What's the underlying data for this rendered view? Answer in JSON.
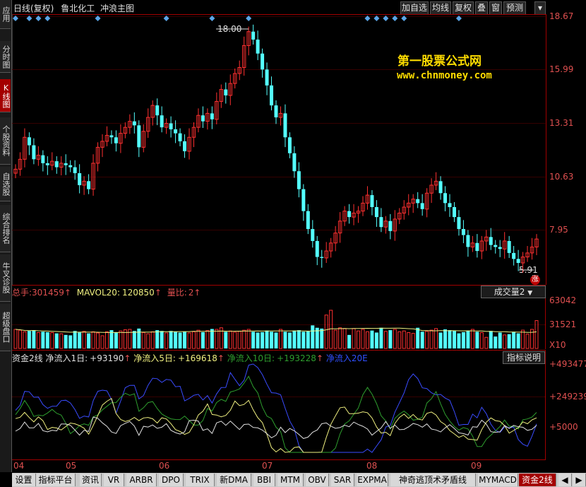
{
  "sidebar": [
    "应用",
    "分时图",
    "K线图",
    "个股资料",
    "自选股",
    "综合排名",
    "牛叉诊股",
    "超级盘口"
  ],
  "header": {
    "title": "日线(复权)",
    "stock": "鲁北化工",
    "formula": "冲浪主图",
    "buttons": [
      "加自选",
      "均线",
      "复权",
      "叠",
      "窗",
      "预测",
      "▾"
    ]
  },
  "price_axis": [
    "18.67",
    "15.99",
    "13.31",
    "10.63",
    "7.95"
  ],
  "annotations": {
    "high": "18.00",
    "low": "5.91",
    "zhang": "涨"
  },
  "watermark": {
    "line1": "第一股票公式网",
    "line2": "www.chnmoney.com"
  },
  "volume": {
    "label_total": "总手:",
    "total": "301459",
    "label_ma": "MAVOL20:",
    "ma": "120850",
    "label_ratio": "量比:",
    "ratio": "2",
    "selector": "成交量2",
    "axis": [
      "63042",
      "31521",
      "X10"
    ]
  },
  "indicator": {
    "name": "资金2线",
    "items": [
      {
        "label": "净流入1日:",
        "value": "+93190",
        "color": "#e0e0e0"
      },
      {
        "label": "净流入5日:",
        "value": "+169618",
        "color": "#f0f080"
      },
      {
        "label": "净流入10日:",
        "value": "+193228",
        "color": "#2e9e2e"
      },
      {
        "label": "净流入20E",
        "value": "",
        "color": "#3050ff"
      }
    ],
    "button": "指标说明",
    "axis": [
      "+493477",
      "+249239",
      "+5000"
    ]
  },
  "x_axis": [
    "04",
    "05",
    "06",
    "07",
    "08",
    "09"
  ],
  "tabs": [
    "设置",
    "指标平台",
    "资讯",
    "VR",
    "ARBR",
    "DPO",
    "TRIX",
    "新DMA",
    "BBI",
    "MTM",
    "OBV",
    "SAR",
    "EXPMA",
    "神奇逃顶术矛盾线",
    "MYMACD",
    "资金2线"
  ],
  "chart_data": {
    "type": "candlestick",
    "ylim": [
      5.91,
      18.67
    ],
    "closes": [
      11.0,
      11.5,
      12.6,
      12.2,
      11.5,
      11.7,
      11.3,
      11.2,
      11.4,
      11.1,
      11.3,
      11.2,
      11.1,
      10.8,
      10.2,
      10.4,
      10.0,
      11.3,
      12.1,
      12.4,
      12.7,
      12.6,
      12.3,
      12.8,
      13.1,
      13.4,
      13.2,
      12.1,
      12.9,
      13.6,
      14.2,
      13.7,
      13.1,
      13.3,
      13.0,
      12.8,
      12.4,
      11.9,
      12.6,
      13.1,
      13.7,
      13.4,
      13.8,
      13.5,
      14.4,
      15.0,
      14.7,
      15.3,
      15.8,
      16.1,
      17.2,
      17.9,
      17.5,
      16.8,
      16.0,
      15.2,
      14.2,
      13.6,
      13.8,
      12.6,
      11.8,
      10.9,
      10.0,
      8.9,
      8.0,
      7.4,
      6.6,
      6.55,
      6.9,
      7.3,
      7.8,
      8.4,
      8.9,
      8.6,
      8.8,
      8.9,
      9.3,
      9.7,
      9.1,
      8.6,
      8.1,
      8.4,
      7.9,
      8.5,
      8.8,
      9.1,
      9.3,
      9.5,
      9.3,
      9.0,
      9.8,
      10.2,
      10.4,
      9.8,
      9.3,
      9.1,
      8.6,
      8.0,
      7.7,
      7.1,
      7.3,
      6.9,
      7.4,
      7.6,
      7.2,
      7.1,
      7.0,
      7.4,
      6.8,
      6.5,
      6.3,
      6.6,
      6.8,
      7.1,
      7.5
    ],
    "volumes": [
      24000,
      23000,
      21000,
      22000,
      23000,
      20000,
      21000,
      20500,
      20000,
      19000,
      18500,
      17000,
      16500,
      22000,
      20000,
      21500,
      19000,
      21000,
      19500,
      16000,
      21000,
      23000,
      20500,
      22000,
      23500,
      24000,
      22000,
      25000,
      20000,
      18500,
      21000,
      23000,
      22000,
      19500,
      22000,
      21000,
      20000,
      21000,
      19500,
      21000,
      23000,
      20500,
      22500,
      24500,
      24000,
      26000,
      21000,
      22000,
      20500,
      21500,
      23000,
      24000,
      21000,
      20000,
      20500,
      22500,
      21000,
      20000,
      24000,
      21000,
      20000,
      22500,
      23000,
      21000,
      21500,
      29000,
      26000,
      25000,
      42000,
      48000,
      23000,
      26000,
      25000,
      17000,
      25000,
      22000,
      24000,
      21000,
      22500,
      20000,
      26000,
      21500,
      23000,
      24000,
      21000,
      22000,
      20000,
      19000,
      26000,
      21000,
      21500,
      23000,
      25000,
      20000,
      24000,
      23000,
      22000,
      19000,
      20500,
      22000,
      24000,
      21000,
      20000,
      14000,
      22000,
      15000,
      20000,
      17000,
      18000,
      21000,
      19000,
      23000,
      18000,
      24000,
      35000
    ],
    "x_ticks": [
      "04",
      "05",
      "06",
      "07",
      "08",
      "09"
    ]
  }
}
